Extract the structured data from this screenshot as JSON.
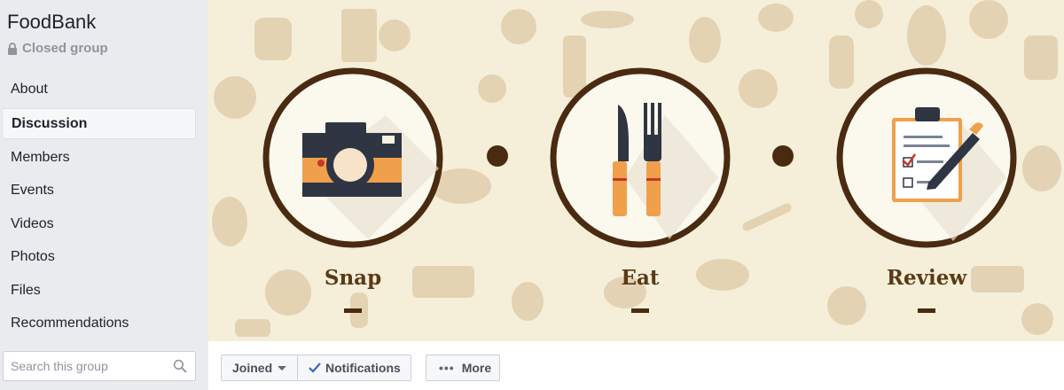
{
  "group": {
    "name": "FoodBank",
    "privacy": "Closed group"
  },
  "nav": {
    "items": [
      {
        "label": "About"
      },
      {
        "label": "Discussion"
      },
      {
        "label": "Members"
      },
      {
        "label": "Events"
      },
      {
        "label": "Videos"
      },
      {
        "label": "Photos"
      },
      {
        "label": "Files"
      },
      {
        "label": "Recommendations"
      }
    ],
    "active": "Discussion"
  },
  "search": {
    "placeholder": "Search this group"
  },
  "cover": {
    "steps": [
      {
        "label": "Snap",
        "icon": "camera-icon"
      },
      {
        "label": "Eat",
        "icon": "knife-fork-icon"
      },
      {
        "label": "Review",
        "icon": "clipboard-pen-icon"
      }
    ],
    "colors": {
      "background": "#f5efd9",
      "ring": "#4a2a10",
      "pattern": "#d8c3a0"
    }
  },
  "actions": {
    "joined_label": "Joined",
    "notifications_label": "Notifications",
    "more_label": "More"
  },
  "colors": {
    "sidebar_bg": "#e9ebee",
    "accent": "#4267b2"
  }
}
